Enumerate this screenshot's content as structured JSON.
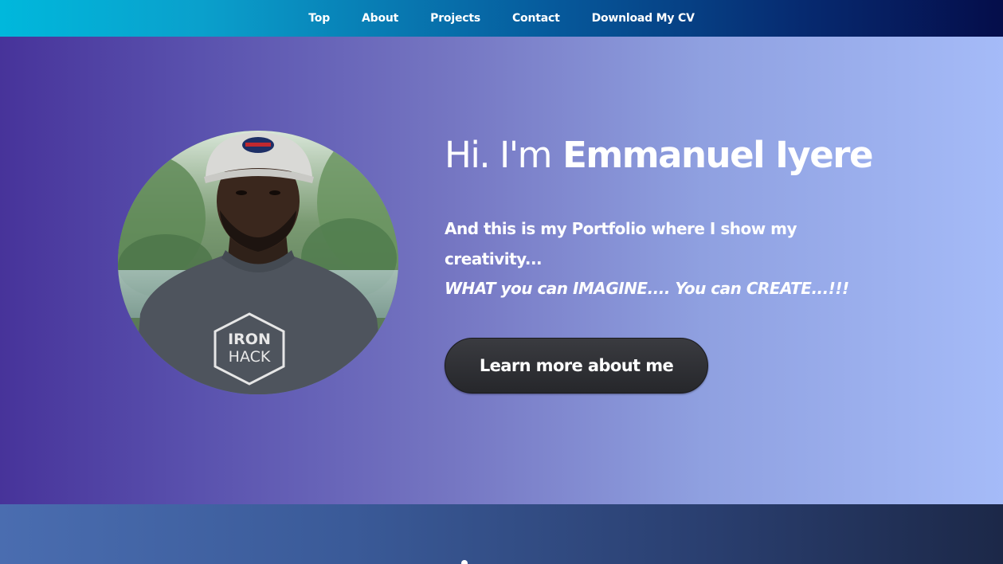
{
  "nav": {
    "items": [
      {
        "label": "Top"
      },
      {
        "label": "About"
      },
      {
        "label": "Projects"
      },
      {
        "label": "Contact"
      },
      {
        "label": "Download My CV"
      }
    ]
  },
  "hero": {
    "greeting": "Hi. I'm",
    "name": "Emmanuel Iyere",
    "intro": "And this is my Portfolio where I show my creativity...",
    "tagline": "WHAT you can IMAGINE.... You can CREATE...!!!",
    "cta_label": "Learn more about me",
    "avatar_shirt_text_line1": "IRON",
    "avatar_shirt_text_line2": "HACK"
  },
  "colors": {
    "nav_gradient_start": "#00b8dc",
    "nav_gradient_end": "#050d4a",
    "hero_gradient_start": "#47339a",
    "hero_gradient_end": "#a5bbf8",
    "button_bg": "#2b2c30",
    "text": "#ffffff"
  }
}
